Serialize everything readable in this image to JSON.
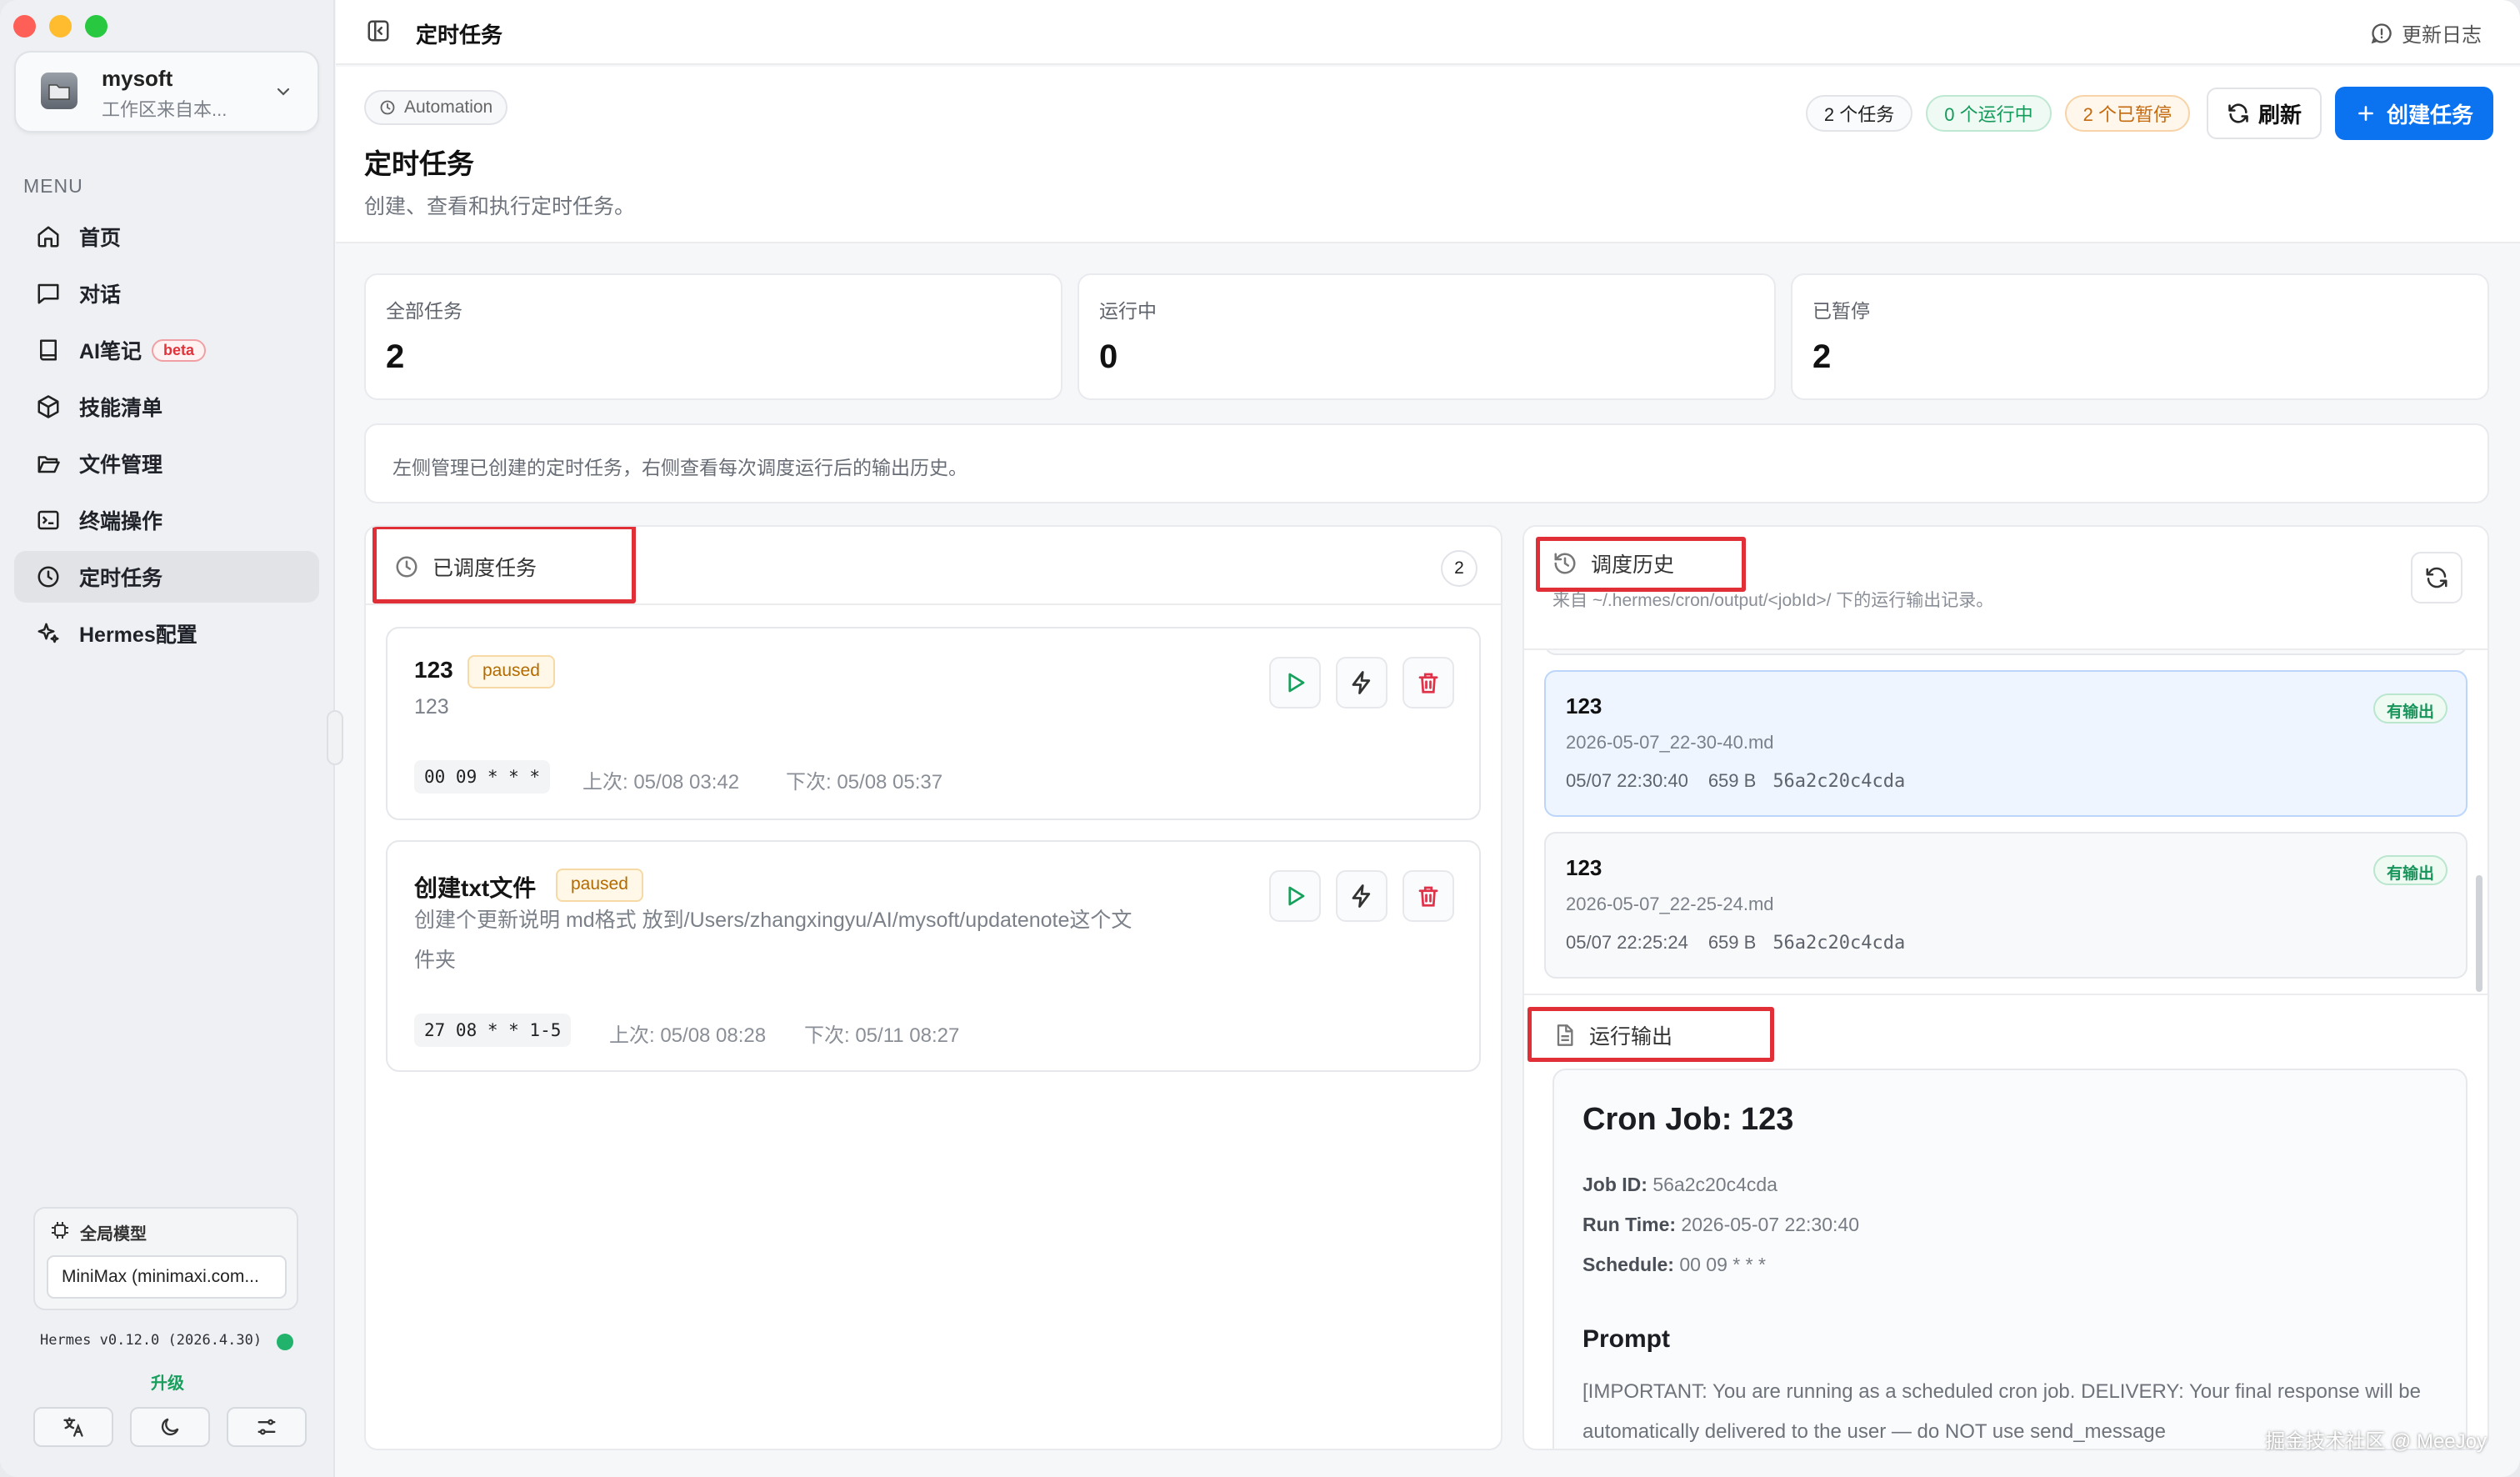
{
  "workspace": {
    "name": "mysoft",
    "subtitle": "工作区来自本..."
  },
  "menu": {
    "title": "MENU",
    "items": [
      {
        "label": "首页",
        "icon": "home-icon"
      },
      {
        "label": "对话",
        "icon": "chat-icon"
      },
      {
        "label": "AI笔记",
        "icon": "notebook-icon",
        "badge": "beta"
      },
      {
        "label": "技能清单",
        "icon": "box-icon"
      },
      {
        "label": "文件管理",
        "icon": "folder-icon"
      },
      {
        "label": "终端操作",
        "icon": "terminal-icon"
      },
      {
        "label": "定时任务",
        "icon": "clock-icon",
        "active": true
      },
      {
        "label": "Hermes配置",
        "icon": "sparkles-icon"
      }
    ]
  },
  "global_model": {
    "title": "全局模型",
    "value": "MiniMax (minimaxi.com..."
  },
  "version": {
    "text": "Hermes v0.12.0 (2026.4.30)",
    "status_color": "#21b36b"
  },
  "upgrade": "升级",
  "topbar": {
    "title": "定时任务",
    "changelog": "更新日志"
  },
  "header": {
    "chip": "Automation",
    "title": "定时任务",
    "desc": "创建、查看和执行定时任务。",
    "badge_total": "2 个任务",
    "badge_running": "0 个运行中",
    "badge_paused": "2 个已暂停",
    "refresh": "刷新",
    "create": "创建任务"
  },
  "stats": [
    {
      "label": "全部任务",
      "value": "2"
    },
    {
      "label": "运行中",
      "value": "0"
    },
    {
      "label": "已暂停",
      "value": "2"
    }
  ],
  "note": "左侧管理已创建的定时任务，右侧查看每次调度运行后的输出历史。",
  "scheduled": {
    "title": "已调度任务",
    "count": "2",
    "tasks": [
      {
        "name": "123",
        "status": "paused",
        "desc": "123",
        "cron": "00 09 * * *",
        "last": "上次: 05/08 03:42",
        "next": "下次: 05/08 05:37"
      },
      {
        "name": "创建txt文件",
        "status": "paused",
        "desc_line1": "创建个更新说明 md格式 放到/Users/zhangxingyu/AI/mysoft/updatenote这个文",
        "desc_line2": "件夹",
        "cron": "27 08 * * 1-5",
        "last": "上次: 05/08 08:28",
        "next": "下次: 05/11 08:27"
      }
    ]
  },
  "history": {
    "title": "调度历史",
    "subtitle": "来自 ~/.hermes/cron/output/<jobId>/ 下的运行输出记录。",
    "runs": [
      {
        "name": "123",
        "file": "2026-05-07_22-30-40.md",
        "time": "05/07 22:30:40",
        "size": "659 B",
        "hash": "56a2c20c4cda",
        "badge": "有输出"
      },
      {
        "name": "123",
        "file": "2026-05-07_22-25-24.md",
        "time": "05/07 22:25:24",
        "size": "659 B",
        "hash": "56a2c20c4cda",
        "badge": "有输出"
      }
    ]
  },
  "output": {
    "title": "运行输出",
    "h1": "Cron Job: 123",
    "job_id_label": "Job ID:",
    "job_id": "56a2c20c4cda",
    "run_time_label": "Run Time:",
    "run_time": "2026-05-07 22:30:40",
    "schedule_label": "Schedule:",
    "schedule": "00 09 * * *",
    "prompt_title": "Prompt",
    "prompt_text": "[IMPORTANT: You are running as a scheduled cron job. DELIVERY: Your final response will be automatically delivered to the user — do NOT use send_message"
  },
  "watermark": "掘金技术社区 @ MeeJoy",
  "colors": {
    "accent": "#0b72f0",
    "highlight": "#e12f37",
    "success": "#159a5c",
    "warning": "#c46a0d"
  }
}
